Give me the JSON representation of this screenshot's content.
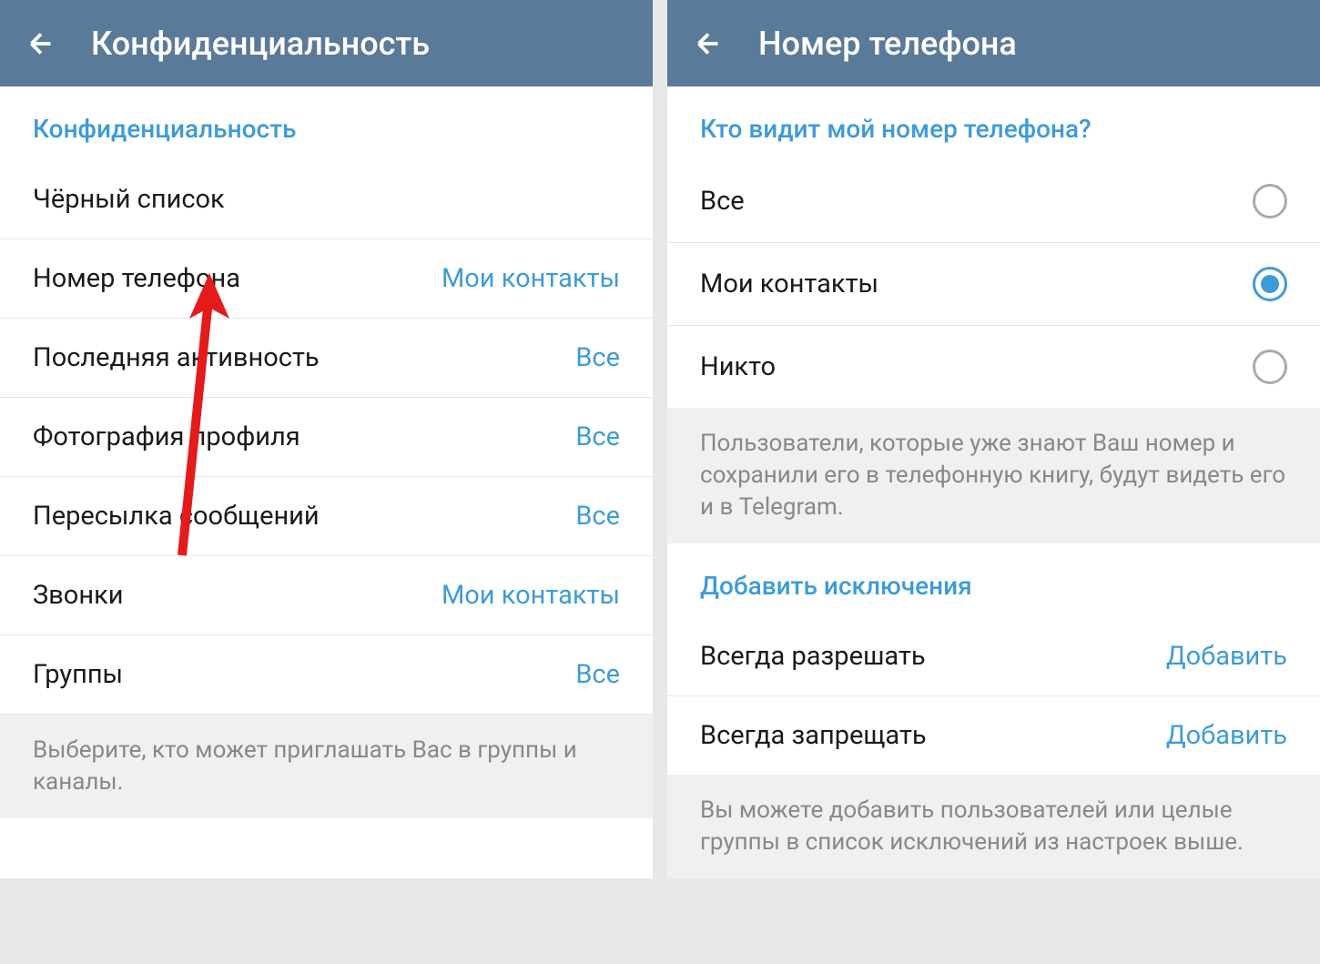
{
  "left": {
    "header_title": "Конфиденциальность",
    "section_title": "Конфиденциальность",
    "rows": [
      {
        "label": "Чёрный список",
        "value": ""
      },
      {
        "label": "Номер телефона",
        "value": "Мои контакты"
      },
      {
        "label": "Последняя активность",
        "value": "Все"
      },
      {
        "label": "Фотография профиля",
        "value": "Все"
      },
      {
        "label": "Пересылка сообщений",
        "value": "Все"
      },
      {
        "label": "Звонки",
        "value": "Мои контакты"
      },
      {
        "label": "Группы",
        "value": "Все"
      }
    ],
    "info": "Выберите, кто может приглашать Вас в группы и каналы."
  },
  "right": {
    "header_title": "Номер телефона",
    "section_title": "Кто видит мой номер телефона?",
    "options": [
      {
        "label": "Все",
        "selected": false
      },
      {
        "label": "Мои контакты",
        "selected": true
      },
      {
        "label": "Никто",
        "selected": false
      }
    ],
    "info1": "Пользователи, которые уже знают Ваш номер и сохранили его в телефонную книгу, будут видеть его и в Telegram.",
    "exceptions_title": "Добавить исключения",
    "exceptions": [
      {
        "label": "Всегда разрешать",
        "action": "Добавить"
      },
      {
        "label": "Всегда запрещать",
        "action": "Добавить"
      }
    ],
    "info2": "Вы можете добавить пользователей или целые группы в список исключений из настроек выше."
  }
}
